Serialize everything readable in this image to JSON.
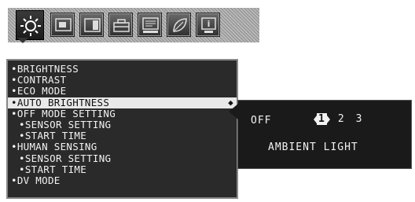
{
  "toolbar": {
    "tabs": [
      {
        "icon": "brightness-icon",
        "active": true
      },
      {
        "icon": "display-position-icon",
        "active": false
      },
      {
        "icon": "split-screen-icon",
        "active": false
      },
      {
        "icon": "tools-icon",
        "active": false
      },
      {
        "icon": "menu-tools-icon",
        "active": false
      },
      {
        "icon": "eco-leaf-icon",
        "active": false
      },
      {
        "icon": "information-icon",
        "active": false
      }
    ]
  },
  "menu": {
    "items": [
      {
        "label": "•BRIGHTNESS"
      },
      {
        "label": "•CONTRAST"
      },
      {
        "label": "•ECO MODE"
      },
      {
        "label": "•AUTO BRIGHTNESS",
        "selected": true
      },
      {
        "label": "•OFF MODE SETTING"
      },
      {
        "label": "•SENSOR SETTING",
        "sub": true
      },
      {
        "label": "•START TIME",
        "sub": true
      },
      {
        "label": "•HUMAN SENSING"
      },
      {
        "label": "•SENSOR SETTING",
        "sub": true
      },
      {
        "label": "•START TIME",
        "sub": true
      },
      {
        "label": "•DV MODE"
      }
    ],
    "scroll_arrows": "◆"
  },
  "submenu": {
    "option_label": "OFF",
    "values": [
      "1",
      "2",
      "3"
    ],
    "selected_value": "1",
    "ambient_label": "AMBIENT LIGHT"
  },
  "colors": {
    "menu_bg": "#2a2a2a",
    "selected_bg": "#e8e8e8",
    "text": "#f2f2f2"
  }
}
